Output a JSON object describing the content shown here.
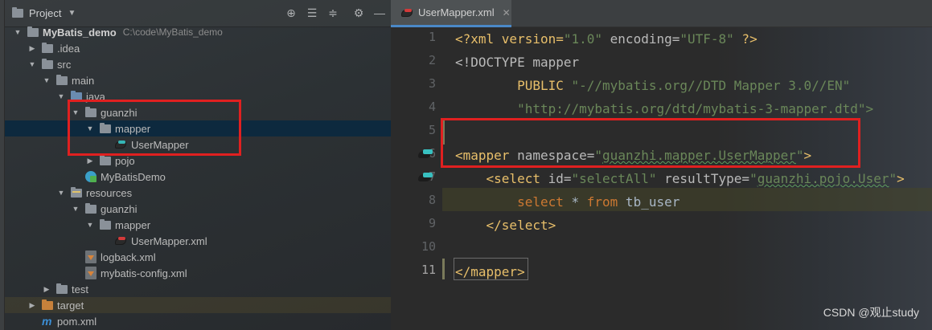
{
  "panel": {
    "title": "Project"
  },
  "tree": [
    {
      "label": "MyBatis_demo",
      "path": "C:\\code\\MyBatis_demo"
    },
    {
      "label": ".idea"
    },
    {
      "label": "src"
    },
    {
      "label": "main"
    },
    {
      "label": "java"
    },
    {
      "label": "guanzhi"
    },
    {
      "label": "mapper"
    },
    {
      "label": "UserMapper"
    },
    {
      "label": "pojo"
    },
    {
      "label": "MyBatisDemo"
    },
    {
      "label": "resources"
    },
    {
      "label": "guanzhi"
    },
    {
      "label": "mapper"
    },
    {
      "label": "UserMapper.xml"
    },
    {
      "label": "logback.xml"
    },
    {
      "label": "mybatis-config.xml"
    },
    {
      "label": "test"
    },
    {
      "label": "target"
    },
    {
      "label": "pom.xml"
    }
  ],
  "editor": {
    "tab_label": "UserMapper.xml",
    "line_numbers": [
      "1",
      "2",
      "3",
      "4",
      "5",
      "6",
      "7",
      "8",
      "9",
      "10",
      "11"
    ],
    "code": {
      "l1_a": "<?xml version=",
      "l1_b": "\"1.0\"",
      "l1_c": " encoding=",
      "l1_d": "\"UTF-8\"",
      "l1_e": " ?>",
      "l2": "<!DOCTYPE mapper",
      "l3_a": "        PUBLIC ",
      "l3_b": "\"-//mybatis.org//DTD Mapper 3.0//EN\"",
      "l4": "        \"http://mybatis.org/dtd/mybatis-3-mapper.dtd\">",
      "l6_a": "<mapper",
      "l6_b": " namespace=",
      "l6_c": "\"",
      "l6_d": "guanzhi.mapper.UserMapper",
      "l6_e": "\"",
      "l6_f": ">",
      "l7_indent": "    ",
      "l7_a": "<select",
      "l7_b": " id=",
      "l7_c": "\"selectAll\"",
      "l7_d": " resultType=",
      "l7_e": "\"",
      "l7_f": "guanzhi.pojo.User",
      "l7_g": "\"",
      "l7_h": ">",
      "l8_indent": "        ",
      "l8_a": "select",
      "l8_b": " * ",
      "l8_c": "from",
      "l8_d": " tb_user",
      "l9": "    </select>",
      "l11_a": "</mapper",
      "l11_b": ">"
    }
  },
  "watermark": "CSDN @观止study",
  "colors": {
    "selection": "#0d293e",
    "annotation_box": "#e02020",
    "tag": "#e8bf6a",
    "string": "#6a8759",
    "keyword": "#cc7832"
  }
}
